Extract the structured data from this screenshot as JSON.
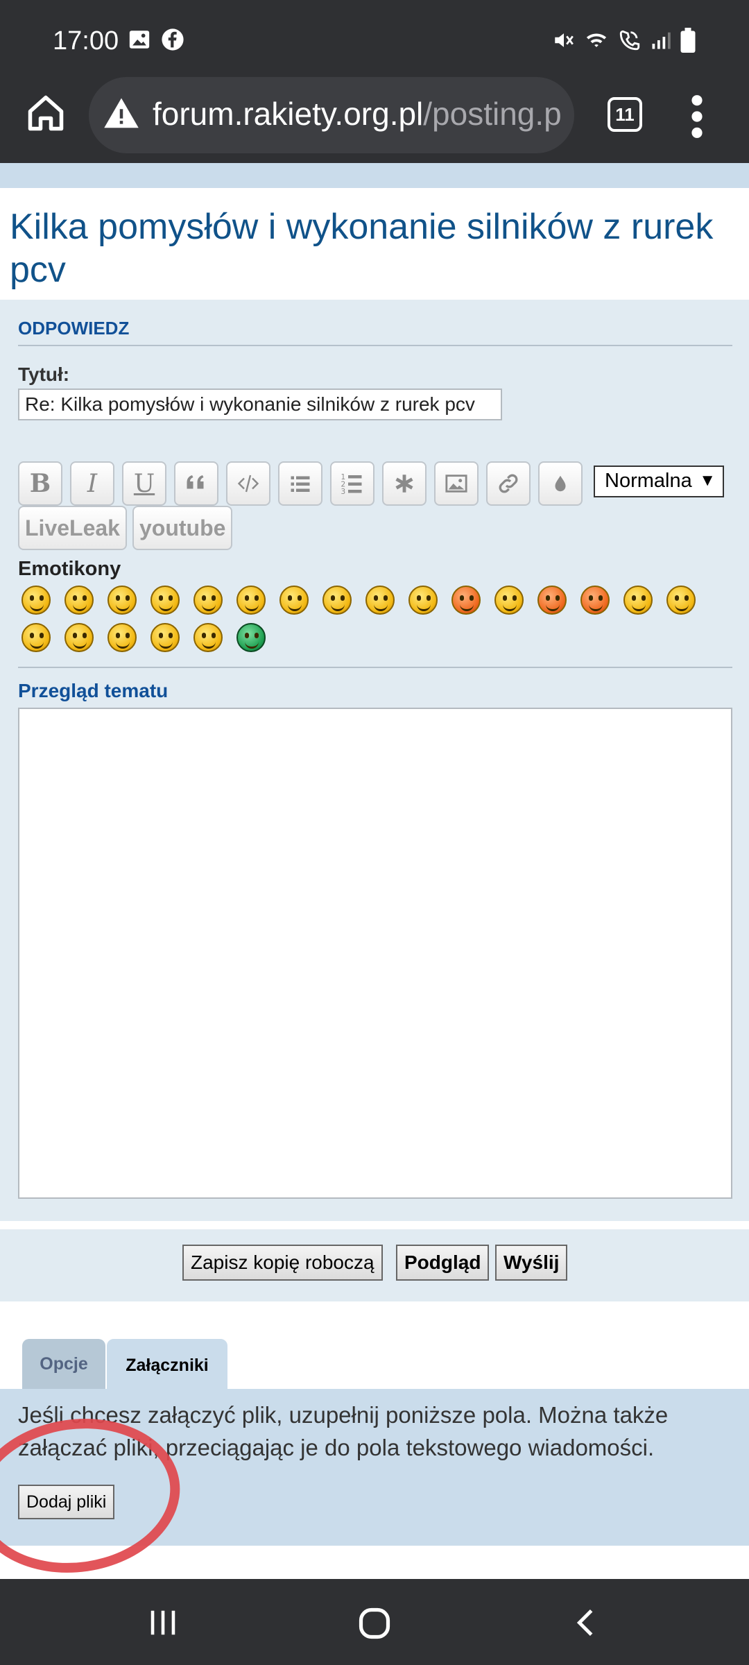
{
  "status_bar": {
    "time": "17:00",
    "left_icons": [
      "image-icon",
      "facebook-icon"
    ],
    "right_icons": [
      "mute-icon",
      "wifi-icon",
      "wifi-call-icon",
      "signal-icon",
      "battery-icon"
    ]
  },
  "browser": {
    "url_domain": "forum.rakiety.org.pl",
    "url_path": "/posting.p",
    "tab_count": "11"
  },
  "page": {
    "title": "Kilka pomysłów i wykonanie silników z rurek pcv"
  },
  "reply": {
    "section_heading": "ODPOWIEDZ",
    "subject_label": "Tytuł:",
    "subject_value": "Re: Kilka pomysłów i wykonanie silników z rurek pcv",
    "toolbar": {
      "bold": "B",
      "italic": "I",
      "underline": "U",
      "font_size_selected": "Normalna",
      "liveleak": "LiveLeak",
      "youtube": "youtube"
    },
    "emoticons_label": "Emotikony",
    "preview_label": "Przegląd tematu"
  },
  "submit": {
    "save_draft": "Zapisz kopię roboczą",
    "preview": "Podgląd",
    "send": "Wyślij"
  },
  "tabs": {
    "options": "Opcje",
    "attachments": "Załączniki"
  },
  "attachments": {
    "info": "Jeśli chcesz załączyć plik, uzupełnij poniższe pola. Można także załączać pliki, przeciągając je do pola tekstowego wiadomości.",
    "add_button": "Dodaj pliki"
  },
  "colors": {
    "link_blue": "#105289",
    "panel_bg": "#e1ebf2",
    "annotation_red": "#e0474c"
  }
}
